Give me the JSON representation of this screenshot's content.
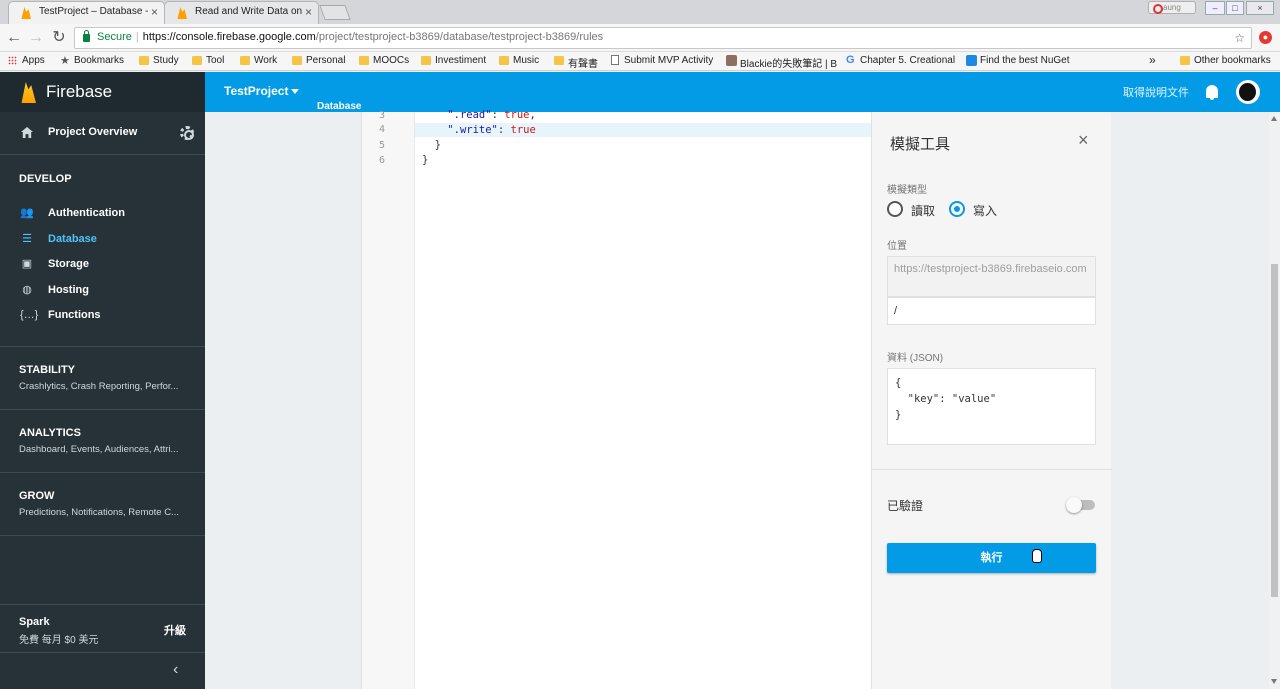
{
  "browser": {
    "tabs": [
      {
        "title": "TestProject – Database -",
        "active": true
      },
      {
        "title": "Read and Write Data on",
        "active": false
      }
    ],
    "user_badge": "aung",
    "secure_label": "Secure",
    "url_host": "https://console.firebase.google.com",
    "url_path": "/project/testproject-b3869/database/testproject-b3869/rules",
    "bookmarks": [
      {
        "label": "Apps",
        "icon": "apps-icon"
      },
      {
        "label": "Bookmarks",
        "icon": "star-icon"
      },
      {
        "label": "Study",
        "icon": "folder-icon"
      },
      {
        "label": "Tool",
        "icon": "folder-icon"
      },
      {
        "label": "Work",
        "icon": "folder-icon"
      },
      {
        "label": "Personal",
        "icon": "folder-icon"
      },
      {
        "label": "MOOCs",
        "icon": "folder-icon"
      },
      {
        "label": "Investiment",
        "icon": "folder-icon"
      },
      {
        "label": "Music",
        "icon": "folder-icon"
      },
      {
        "label": "有聲書",
        "icon": "folder-icon"
      },
      {
        "label": "Submit MVP Activity",
        "icon": "doc-icon"
      },
      {
        "label": "Blackie的失敗筆記 | B",
        "icon": "avatar-icon"
      },
      {
        "label": "Chapter 5. Creational",
        "icon": "google-icon"
      },
      {
        "label": "Find the best NuGet",
        "icon": "nuget-icon"
      }
    ],
    "more_bookmarks": "»",
    "other_bookmarks": "Other bookmarks"
  },
  "sidebar": {
    "brand": "Firebase",
    "project_overview": "Project Overview",
    "develop_title": "DEVELOP",
    "develop_items": [
      {
        "label": "Authentication",
        "icon": "people-icon",
        "active": false
      },
      {
        "label": "Database",
        "icon": "database-icon",
        "active": true
      },
      {
        "label": "Storage",
        "icon": "image-icon",
        "active": false
      },
      {
        "label": "Hosting",
        "icon": "globe-icon",
        "active": false
      },
      {
        "label": "Functions",
        "icon": "functions-icon",
        "active": false
      }
    ],
    "stability": {
      "title": "STABILITY",
      "sub": "Crashlytics, Crash Reporting, Perfor..."
    },
    "analytics": {
      "title": "ANALYTICS",
      "sub": "Dashboard, Events, Audiences, Attri..."
    },
    "grow": {
      "title": "GROW",
      "sub": "Predictions, Notifications, Remote C..."
    },
    "plan_name": "Spark",
    "plan_desc": "免費 每月 $0 美元",
    "upgrade": "升級",
    "collapse": "‹"
  },
  "topbar": {
    "project": "TestProject",
    "section": "Database",
    "help": "取得說明文件"
  },
  "editor": {
    "lines": [
      {
        "num": "3",
        "key": "\".read\"",
        "val": "true",
        "tail": ","
      },
      {
        "num": "4",
        "key": "\".write\"",
        "val": "true",
        "tail": ""
      },
      {
        "num": "5",
        "text": "  }"
      },
      {
        "num": "6",
        "text": "}"
      }
    ]
  },
  "simulator": {
    "title": "模擬工具",
    "type_label": "模擬類型",
    "read_label": "讀取",
    "write_label": "寫入",
    "selected": "write",
    "location_label": "位置",
    "base_url": "https://testproject-b3869.firebaseio.com",
    "path": "/",
    "data_label": "資料 (JSON)",
    "data_json": "{\n  \"key\": \"value\"\n}",
    "auth_label": "已驗證",
    "auth_enabled": false,
    "run_label": "執行"
  }
}
